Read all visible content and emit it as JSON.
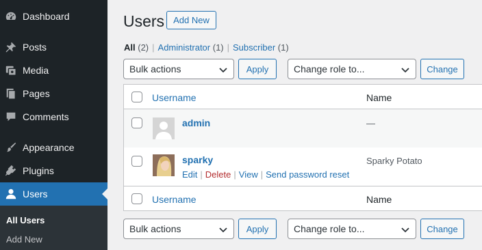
{
  "sidebar": {
    "items": [
      {
        "label": "Dashboard",
        "icon": "dashboard-icon"
      },
      {
        "label": "Posts",
        "icon": "pin-icon"
      },
      {
        "label": "Media",
        "icon": "media-icon"
      },
      {
        "label": "Pages",
        "icon": "pages-icon"
      },
      {
        "label": "Comments",
        "icon": "comment-icon"
      },
      {
        "label": "Appearance",
        "icon": "paintbrush-icon"
      },
      {
        "label": "Plugins",
        "icon": "plugin-icon"
      },
      {
        "label": "Users",
        "icon": "user-icon"
      }
    ],
    "submenu": [
      "All Users",
      "Add New"
    ],
    "colors": {
      "background": "#1d2327",
      "active": "#2271b1",
      "submenu": "#2c3338"
    }
  },
  "header": {
    "title": "Users",
    "add_new_label": "Add New"
  },
  "views": [
    {
      "label": "All",
      "count": "(2)"
    },
    {
      "label": "Administrator",
      "count": "(1)"
    },
    {
      "label": "Subscriber",
      "count": "(1)"
    }
  ],
  "views_separator": "|",
  "top_controls": {
    "bulk_value": "Bulk actions",
    "apply_label": "Apply",
    "role_value": "Change role to...",
    "change_label": "Change"
  },
  "bottom_controls": {
    "bulk_value": "Bulk actions",
    "apply_label": "Apply",
    "role_value": "Change role to...",
    "change_label": "Change"
  },
  "table": {
    "columns": [
      "Username",
      "Name"
    ],
    "footer_columns": [
      "Username",
      "Name"
    ],
    "rows": [
      {
        "username": "admin",
        "name": "—"
      },
      {
        "username": "sparky",
        "name": "Sparky Potato",
        "actions": [
          "Edit",
          "Delete",
          "View",
          "Send password reset"
        ]
      }
    ]
  },
  "accent_color": "#2271b1",
  "delete_color": "#b32d2e"
}
